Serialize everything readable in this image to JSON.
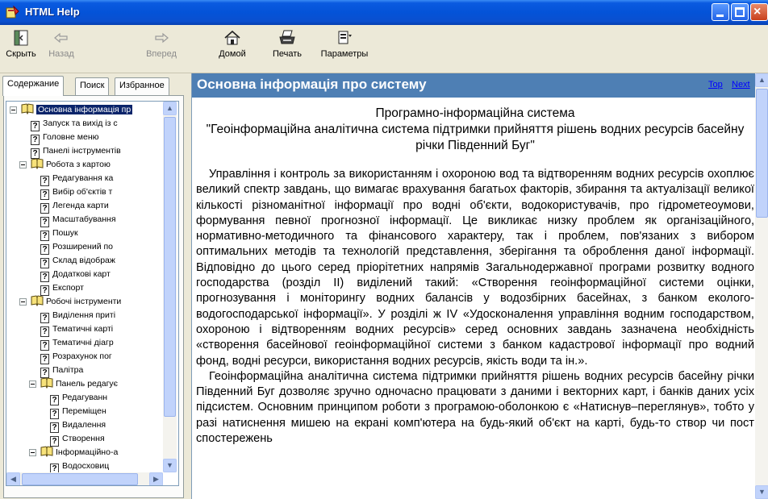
{
  "window": {
    "title": "HTML Help",
    "close_glyph": "×",
    "colors": {
      "titlebar": "#0453d8",
      "topic_header": "#4e7fb4",
      "link": "#0000ff",
      "selection": "#0a246a"
    }
  },
  "toolbar": {
    "hide_label": "Скрыть",
    "back_label": "Назад",
    "forward_label": "Вперед",
    "home_label": "Домой",
    "print_label": "Печать",
    "options_label": "Параметры",
    "icons": [
      "hide-pane-icon",
      "back-arrow-icon",
      "forward-arrow-icon",
      "home-icon",
      "printer-icon",
      "options-icon"
    ]
  },
  "nav": {
    "tabs": [
      "Содержание",
      "Поиск",
      "Избранное"
    ],
    "tree": [
      {
        "kind": "book",
        "label": "Основна інформація пр"
      },
      {
        "kind": "page",
        "label": "Запуск та вихід із с"
      },
      {
        "kind": "page",
        "label": "Головне меню"
      },
      {
        "kind": "page",
        "label": "Панелі інструментів"
      },
      {
        "kind": "book",
        "label": "Робота з картою"
      },
      {
        "kind": "page",
        "label": "Редагування ка"
      },
      {
        "kind": "page",
        "label": "Вибір об'єктів т"
      },
      {
        "kind": "page",
        "label": "Легенда карти"
      },
      {
        "kind": "page",
        "label": "Масштабування"
      },
      {
        "kind": "page",
        "label": "Пошук"
      },
      {
        "kind": "page",
        "label": "Розширений по"
      },
      {
        "kind": "page",
        "label": "Склад відображ"
      },
      {
        "kind": "page",
        "label": "Додаткові карт"
      },
      {
        "kind": "page",
        "label": "Експорт"
      },
      {
        "kind": "book",
        "label": "Робочі інструменти"
      },
      {
        "kind": "page",
        "label": "Виділення приті"
      },
      {
        "kind": "page",
        "label": "Тематичні карті"
      },
      {
        "kind": "page",
        "label": "Тематичні діагр"
      },
      {
        "kind": "page",
        "label": "Розрахунок пог"
      },
      {
        "kind": "page",
        "label": "Палітра"
      },
      {
        "kind": "book",
        "label": "Панель редагує"
      },
      {
        "kind": "page",
        "label": "Редагуванн"
      },
      {
        "kind": "page",
        "label": "Переміщен"
      },
      {
        "kind": "page",
        "label": "Видалення"
      },
      {
        "kind": "page",
        "label": "Створення"
      },
      {
        "kind": "book",
        "label": "Інформаційно-а"
      },
      {
        "kind": "page",
        "label": "Водосховиц"
      }
    ]
  },
  "content": {
    "topic_title": "Основна інформація про систему",
    "link_top": "Top",
    "link_next": "Next",
    "heading_line1": "Програмно-інформаційна система",
    "heading_line2": "\"Геоінформаційна аналітична система підтримки прийняття рішень водних ресурсів басейну річки Південний Буг\"",
    "paragraph1": "Управління і контроль за використанням і охороною вод та відтворенням водних ресурсів охоплює великий спектр завдань, що вимагає врахування багатьох факторів, збирання та актуалізації великої кількості різноманітної інформації про водні об'єкти, водокористувачів, про гідрометеоумови, формування певної прогнозної інформації. Це викликає низку проблем як організаційного, нормативно-методичного та фінансового характеру, так і проблем, пов'язаних з вибором оптимальних методів та технологій представлення, зберігання та оброблення даної інформації. Відповідно до цього серед пріорітетних напрямів Загальнодержавної програми розвитку водного господарства (розділ II) виділений такий: «Створення геоінформаційної системи оцінки, прогнозування і моніторингу водних балансів у водозбірних басейнах, з банком еколого-водогосподарської інформації». У розділі ж IV «Удосконалення управління водним господарством, охороною і відтворенням водних ресурсів» серед основних завдань зазначена необхідність «створення басейнової геоінформаційної системи з банком кадастрової інформації про водний фонд, водні ресурси, використання водних ресурсів, якість води та ін.».",
    "paragraph2": "Геоінформаційна аналітична система підтримки прийняття рішень водних ресурсів басейну річки Південний Буг дозволяє зручно одночасно працювати з даними і векторних карт, і банків даних усіх підсистем. Основним принципом роботи з програмою-оболонкою є «Натиснув–переглянув», тобто у разі натиснення мишею на екрані комп'ютера на будь-який об'єкт на карті, будь-то створ чи пост спостережень"
  }
}
